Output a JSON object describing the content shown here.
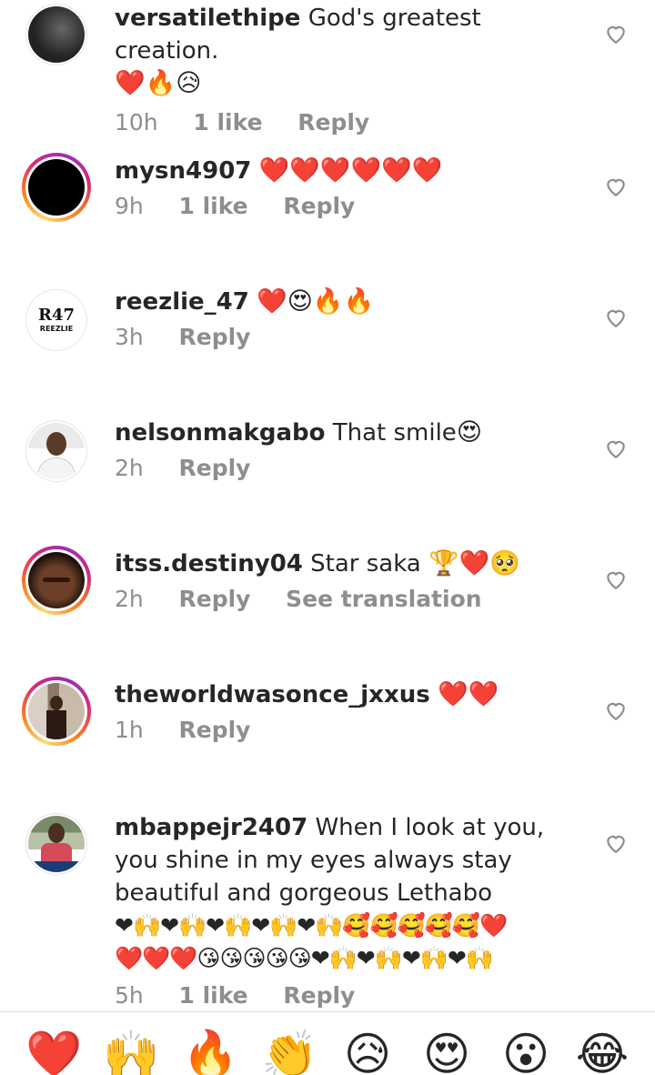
{
  "comments": [
    {
      "username": "versatilethipe",
      "text": "God's greatest creation.",
      "emojis": "❤️🔥😥",
      "time": "10h",
      "likes": "1 like",
      "reply": "Reply"
    },
    {
      "username": "mysn4907",
      "text": "",
      "emojis": "❤️❤️❤️❤️❤️❤️",
      "time": "9h",
      "likes": "1 like",
      "reply": "Reply"
    },
    {
      "username": "reezlie_47",
      "text": "",
      "emojis": "❤️😍🔥🔥",
      "time": "3h",
      "reply": "Reply",
      "avatar_text_top": "R47",
      "avatar_text_bottom": "REEZLIE"
    },
    {
      "username": "nelsonmakgabo",
      "text": "That smile",
      "emojis": "😍",
      "time": "2h",
      "reply": "Reply"
    },
    {
      "username": "itss.destiny04",
      "text": "Star saka",
      "emojis": "🏆❤️🥺",
      "time": "2h",
      "reply": "Reply",
      "see_translation": "See translation"
    },
    {
      "username": "theworldwasonce_jxxus",
      "text": "",
      "emojis": "❤️❤️",
      "time": "1h",
      "reply": "Reply"
    },
    {
      "username": "mbappejr2407",
      "text": "When I look at you, you shine in my eyes always stay beautiful and gorgeous Lethabo",
      "emojis_line1": "❤🙌❤🙌❤🙌❤🙌❤🙌🥰🥰🥰🥰🥰❤️",
      "emojis_line2": "❤️❤️❤️😘😘😘😘😘❤🙌❤🙌❤🙌❤🙌",
      "time": "5h",
      "likes": "1 like",
      "reply": "Reply"
    }
  ],
  "reactions": [
    "❤️",
    "🙌",
    "🔥",
    "👏",
    "😥",
    "😍",
    "😮",
    "😂"
  ],
  "colors": {
    "meta": "#8e8e8e",
    "text": "#262626",
    "ring_start": "#feda75",
    "ring_mid": "#d62976"
  }
}
